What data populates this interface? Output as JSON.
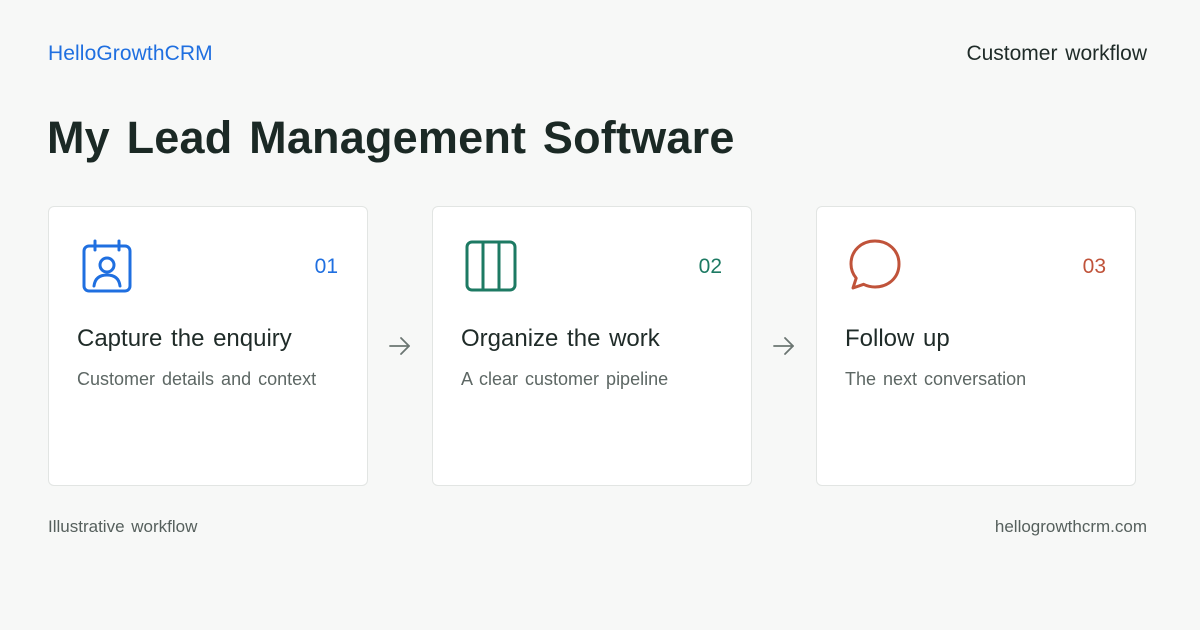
{
  "header": {
    "brand": "HelloGrowthCRM",
    "label": "Customer workflow"
  },
  "page_title": "My Lead Management Software",
  "steps": [
    {
      "number": "01",
      "title": "Capture the enquiry",
      "description": "Customer details and context",
      "icon": "contact-card-icon",
      "color": "#1f6fe0"
    },
    {
      "number": "02",
      "title": "Organize the work",
      "description": "A clear customer pipeline",
      "icon": "pipeline-columns-icon",
      "color": "#1d7a63"
    },
    {
      "number": "03",
      "title": "Follow up",
      "description": "The next conversation",
      "icon": "chat-bubble-icon",
      "color": "#c0533a"
    }
  ],
  "arrow_icon": "arrow-right-icon",
  "footer": {
    "note": "Illustrative workflow",
    "url": "hellogrowthcrm.com"
  }
}
